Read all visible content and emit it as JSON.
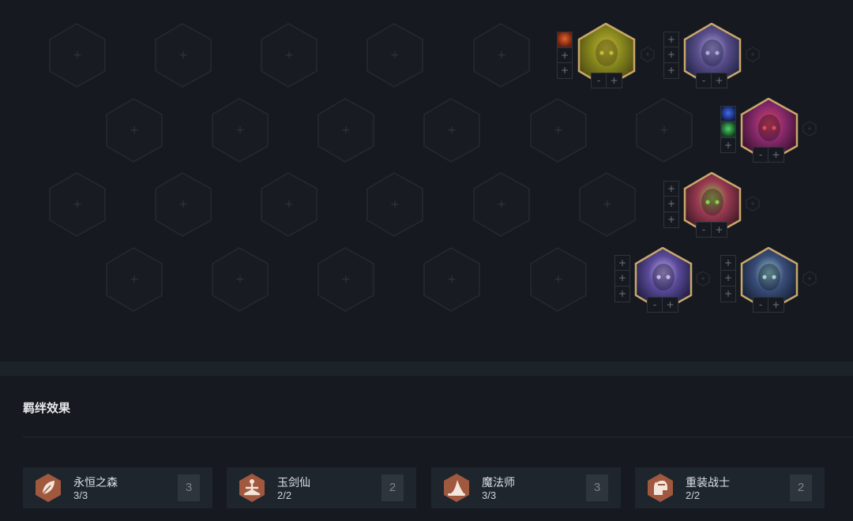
{
  "board": {
    "empty_slot_symbol": "+",
    "stepper_minus": "-",
    "stepper_plus": "+",
    "item_slot_symbol": "+",
    "champions": [
      {
        "name": "tree-golem",
        "border": "#c9a86a",
        "colors": [
          "#8a8a1e",
          "#4d4a12",
          "#c8b93a"
        ],
        "items": [
          "fire-item"
        ]
      },
      {
        "name": "dark-sorcerer",
        "border": "#c9a86a",
        "colors": [
          "#5a4e8c",
          "#1f2344",
          "#b1a6e0"
        ],
        "items": []
      },
      {
        "name": "many-eyed-creature",
        "border": "#c9a86a",
        "colors": [
          "#8a2a6d",
          "#35102c",
          "#e04a55"
        ],
        "items": [
          "blue-orb-item",
          "green-item"
        ]
      },
      {
        "name": "grinning-jester",
        "border": "#c9a86a",
        "colors": [
          "#9a3a52",
          "#3c1822",
          "#8bd14a"
        ],
        "items": []
      },
      {
        "name": "purple-haired-mage",
        "border": "#c9a86a",
        "colors": [
          "#5a4a9a",
          "#1d1b3c",
          "#c9b8f0"
        ],
        "items": []
      },
      {
        "name": "jade-swordmaiden",
        "border": "#c9a86a",
        "colors": [
          "#3a4e7a",
          "#141d30",
          "#9fd4d0"
        ],
        "items": []
      }
    ]
  },
  "synergy": {
    "title": "羁绊效果",
    "traits": [
      {
        "name": "永恒之森",
        "count": "3/3",
        "total": "3",
        "icon": "leaf-icon",
        "badge_color": "#a0583e"
      },
      {
        "name": "玉剑仙",
        "count": "2/2",
        "total": "2",
        "icon": "meditation-icon",
        "badge_color": "#a0583e"
      },
      {
        "name": "魔法师",
        "count": "3/3",
        "total": "3",
        "icon": "wizard-hat-icon",
        "badge_color": "#a0583e"
      },
      {
        "name": "重装战士",
        "count": "2/2",
        "total": "2",
        "icon": "helmet-icon",
        "badge_color": "#a0583e"
      }
    ]
  }
}
